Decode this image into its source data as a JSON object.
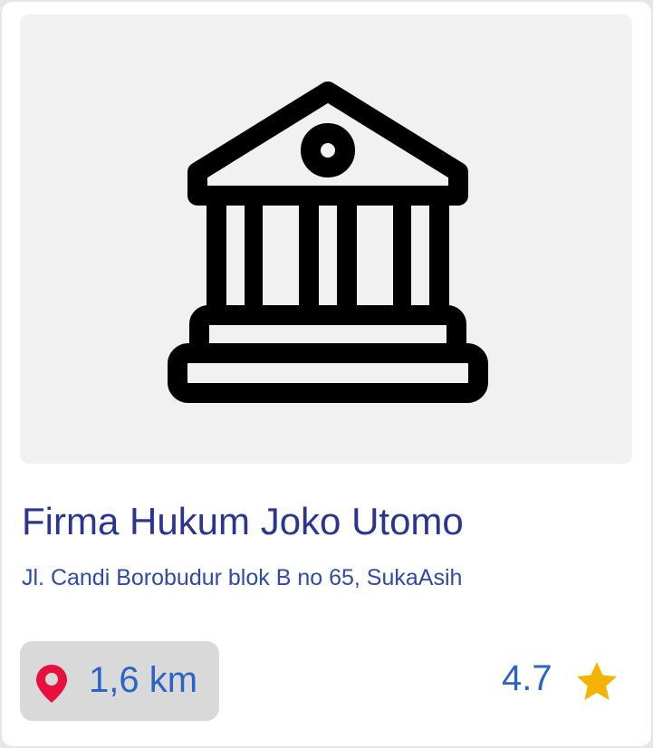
{
  "card": {
    "title": "Firma Hukum Joko Utomo",
    "address": "Jl. Candi Borobudur blok B no 65, SukaAsih",
    "distance": "1,6 km",
    "rating": "4.7",
    "icons": {
      "image": "courthouse-icon",
      "distance": "location-pin-icon",
      "rating": "star-icon"
    }
  },
  "colors": {
    "title": "#2a3590",
    "address": "#2f4aa8",
    "accent_text": "#2b63c6",
    "pin": "#e8103f",
    "star": "#f5b301",
    "badge_bg": "#d9d9d9",
    "image_bg": "#f1f1f1"
  }
}
